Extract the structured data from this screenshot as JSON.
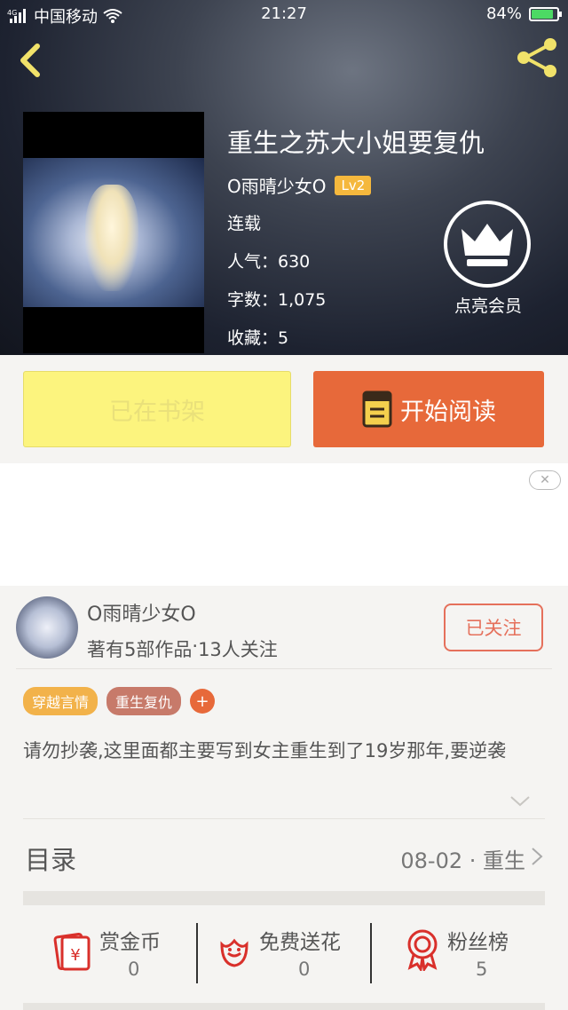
{
  "statusbar": {
    "carrier": "中国移动",
    "time": "21:27",
    "battery": "84%",
    "battery_level": 0.84,
    "signal_icon": "signal-icon",
    "wifi_icon": "wifi-icon"
  },
  "header": {
    "back_icon": "chevron-left-icon",
    "share_icon": "share-icon"
  },
  "book": {
    "title": "重生之苏大小姐要复仇",
    "author": "O雨晴少女O",
    "level": "Lv2",
    "status": "连载",
    "popularity": "人气：630",
    "word_count": "字数：1,075",
    "favorites": "收藏：5"
  },
  "vip": {
    "label": "点亮会员",
    "icon": "crown-icon"
  },
  "buttons": {
    "shelf_label": "已在书架",
    "read_label": "开始阅读",
    "read_icon": "book-icon"
  },
  "ad": {
    "close_glyph": "✕"
  },
  "author_card": {
    "name": "O雨晴少女O",
    "works": "著有5部作品",
    "separator": "·",
    "followers": "13人关注",
    "follow_label": "已关注"
  },
  "tags": [
    {
      "label": "穿越言情"
    },
    {
      "label": "重生复仇"
    }
  ],
  "tag_add_glyph": "+",
  "description": "请勿抄袭,这里面都主要写到女主重生到了19岁那年,要逆袭",
  "toc": {
    "title": "目录",
    "latest": "08-02 · 重生"
  },
  "actions": {
    "reward": {
      "label": "赏金币",
      "value": "0",
      "icon": "red-envelope-icon"
    },
    "flower": {
      "label": "免费送花",
      "value": "0",
      "icon": "flower-icon"
    },
    "fans": {
      "label": "粉丝榜",
      "value": "5",
      "icon": "medal-icon"
    }
  },
  "colors": {
    "accent_orange": "#e7693a",
    "shelf_yellow": "#fcf47e",
    "badge_yellow": "#f5b83d",
    "follow_red": "#e5705b"
  }
}
